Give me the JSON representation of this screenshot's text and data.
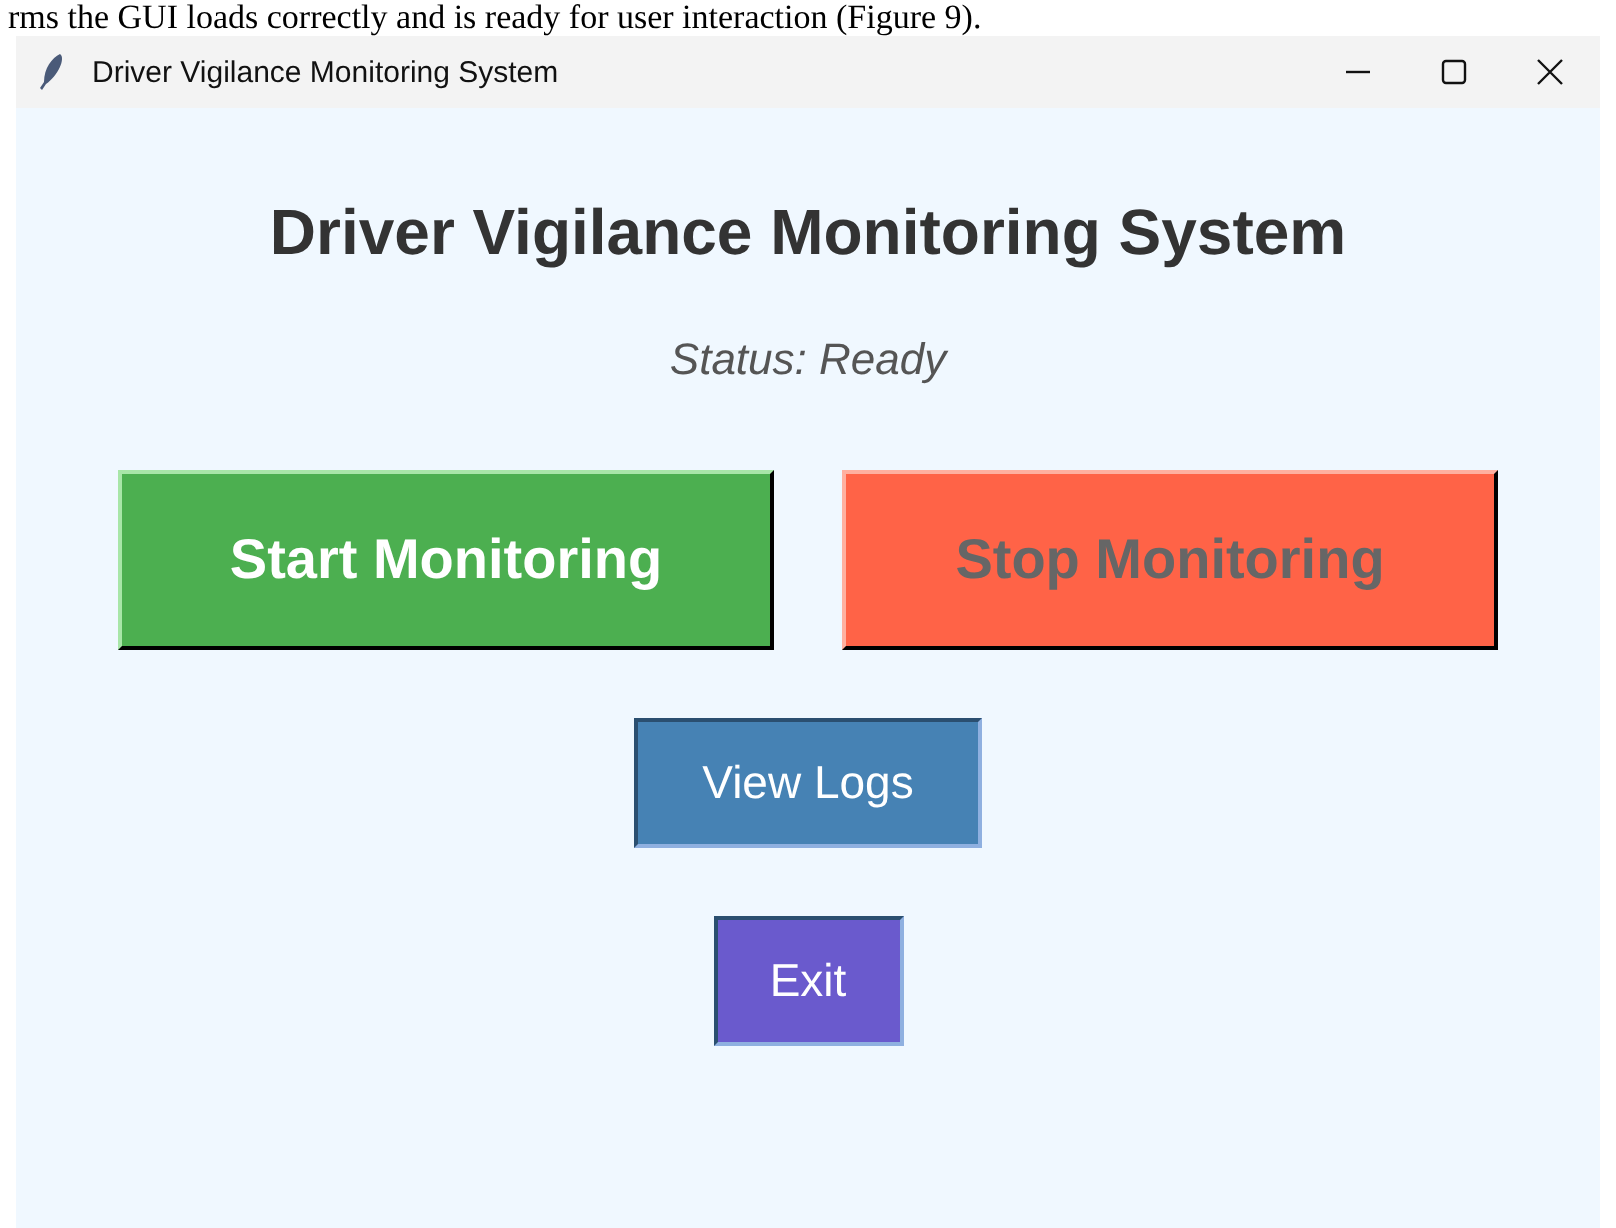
{
  "caption": "rms the GUI loads correctly and is ready for user interaction (Figure 9).",
  "window": {
    "title": "Driver Vigilance Monitoring System"
  },
  "heading": "Driver Vigilance Monitoring System",
  "status": "Status: Ready",
  "main_buttons": [
    {
      "label": "Start Monitoring",
      "color": "#4caf50",
      "disabled": false
    },
    {
      "label": "Stop Monitoring",
      "color": "#ff6347",
      "disabled": true
    }
  ],
  "buttons": [
    {
      "label": "View Logs",
      "color": "#4682b4"
    },
    {
      "label": "Exit",
      "color": "#6a5acd"
    }
  ]
}
